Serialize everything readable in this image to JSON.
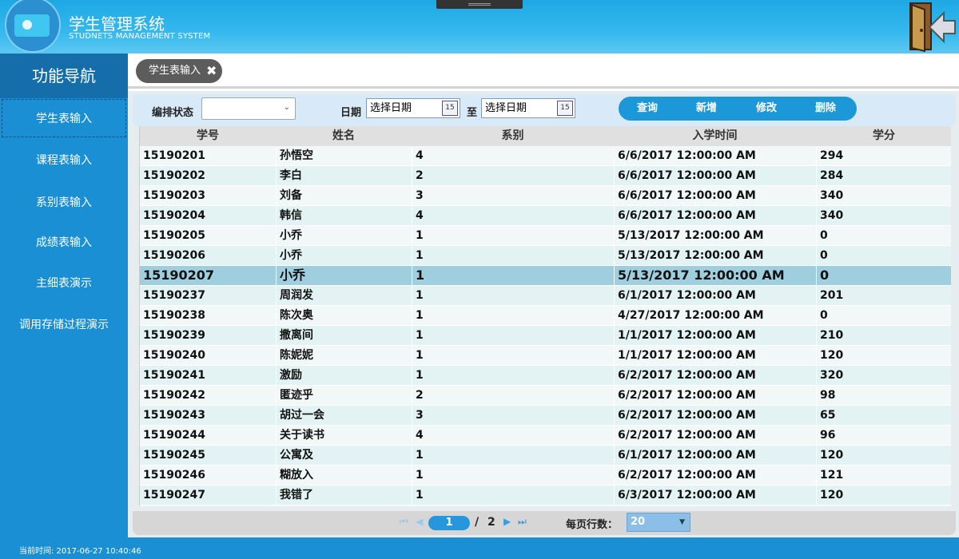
{
  "app": {
    "title_cn": "学生管理系统",
    "title_en": "STUDNETS MANAGEMENT SYSTEM"
  },
  "sidebar": {
    "header": "功能导航",
    "items": [
      {
        "label": "学生表输入",
        "active": true
      },
      {
        "label": "课程表输入",
        "active": false
      },
      {
        "label": "系别表输入",
        "active": false
      },
      {
        "label": "成绩表输入",
        "active": false
      },
      {
        "label": "主细表演示",
        "active": false
      },
      {
        "label": "调用存储过程演示",
        "active": false
      }
    ]
  },
  "tabs": [
    {
      "label": "学生表输入",
      "close_icon": "✖"
    }
  ],
  "toolbar": {
    "status_label": "编排状态",
    "status_value": "",
    "date_label": "日期",
    "date_from_placeholder": "选择日期",
    "to_label": "至",
    "date_to_placeholder": "选择日期",
    "calendar_icon_text": "15",
    "buttons": {
      "query": "查询",
      "add": "新增",
      "edit": "修改",
      "delete": "删除"
    }
  },
  "table": {
    "columns": [
      "学号",
      "姓名",
      "系别",
      "入学时间",
      "学分"
    ],
    "selected_index": 6,
    "rows": [
      [
        "15190201",
        "孙悟空",
        "4",
        "6/6/2017 12:00:00 AM",
        "294"
      ],
      [
        "15190202",
        "李白",
        "2",
        "6/6/2017 12:00:00 AM",
        "284"
      ],
      [
        "15190203",
        "刘备",
        "3",
        "6/6/2017 12:00:00 AM",
        "340"
      ],
      [
        "15190204",
        "韩信",
        "4",
        "6/6/2017 12:00:00 AM",
        "340"
      ],
      [
        "15190205",
        "小乔",
        "1",
        "5/13/2017 12:00:00 AM",
        "0"
      ],
      [
        "15190206",
        "小乔",
        "1",
        "5/13/2017 12:00:00 AM",
        "0"
      ],
      [
        "15190207",
        "小乔",
        "1",
        "5/13/2017 12:00:00 AM",
        "0"
      ],
      [
        "15190237",
        "周润发",
        "1",
        "6/1/2017 12:00:00 AM",
        "201"
      ],
      [
        "15190238",
        "陈次奥",
        "1",
        "4/27/2017 12:00:00 AM",
        "0"
      ],
      [
        "15190239",
        "撒离间",
        "1",
        "1/1/2017 12:00:00 AM",
        "210"
      ],
      [
        "15190240",
        "陈妮妮",
        "1",
        "1/1/2017 12:00:00 AM",
        "120"
      ],
      [
        "15190241",
        "激励",
        "1",
        "6/2/2017 12:00:00 AM",
        "320"
      ],
      [
        "15190242",
        "匿迹乎",
        "2",
        "6/2/2017 12:00:00 AM",
        "98"
      ],
      [
        "15190243",
        "胡过一会",
        "3",
        "6/2/2017 12:00:00 AM",
        "65"
      ],
      [
        "15190244",
        "关于读书",
        "4",
        "6/2/2017 12:00:00 AM",
        "96"
      ],
      [
        "15190245",
        "公寓及",
        "1",
        "6/1/2017 12:00:00 AM",
        "120"
      ],
      [
        "15190246",
        "糊放入",
        "1",
        "6/2/2017 12:00:00 AM",
        "121"
      ],
      [
        "15190247",
        "我错了",
        "1",
        "6/3/2017 12:00:00 AM",
        "120"
      ]
    ]
  },
  "pager": {
    "current_page": "1",
    "separator": "/",
    "total_pages": "2",
    "page_size_label": "每页行数：",
    "page_size": "20",
    "first_icon": "⏮",
    "prev_icon": "◀",
    "next_icon": "▶",
    "last_icon": "⏭"
  },
  "footer": {
    "time_text": "当前时间: 2017-06-27 10:40:46"
  },
  "colors": {
    "header": "#35b8ee",
    "sidebar": "#1a8fd3",
    "sidebar_header": "#156da9",
    "action_bar": "#1c97d8",
    "selected_row": "#9fcfdf"
  }
}
